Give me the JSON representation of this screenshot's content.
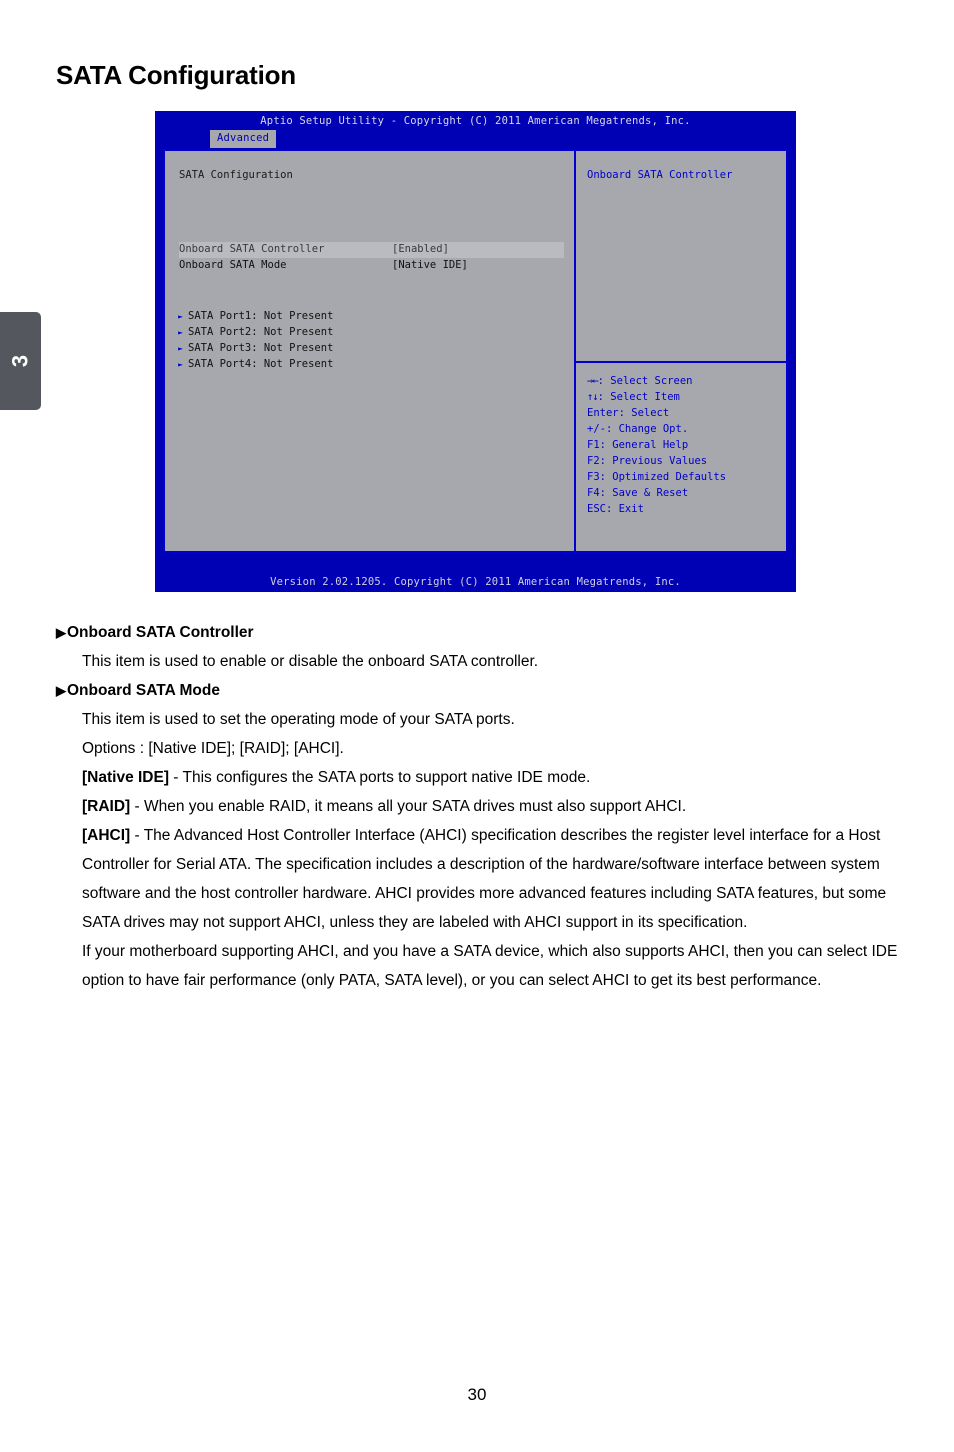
{
  "chapter": {
    "number": "3"
  },
  "page": {
    "title": "SATA Configuration",
    "number": "30"
  },
  "bios": {
    "titlebar": "Aptio Setup Utility - Copyright (C) 2011 American Megatrends, Inc.",
    "active_tab": "Advanced",
    "section_title": "SATA Configuration",
    "options": [
      {
        "label": "Onboard SATA Controller",
        "value": "[Enabled]",
        "selected": true
      },
      {
        "label": "Onboard SATA Mode",
        "value": "[Native IDE]",
        "selected": false
      }
    ],
    "ports": [
      {
        "label": "SATA Port1: Not Present"
      },
      {
        "label": "SATA Port2: Not Present"
      },
      {
        "label": "SATA Port3: Not Present"
      },
      {
        "label": "SATA Port4: Not Present"
      }
    ],
    "help_title": "Onboard SATA Controller",
    "keys": [
      {
        "glyph": "→←",
        "text": ": Select Screen"
      },
      {
        "glyph": "↑↓",
        "text": ": Select Item"
      },
      {
        "glyph": "",
        "text": "Enter: Select"
      },
      {
        "glyph": "",
        "text": "+/-: Change Opt."
      },
      {
        "glyph": "",
        "text": "F1: General Help"
      },
      {
        "glyph": "",
        "text": "F2: Previous Values"
      },
      {
        "glyph": "",
        "text": "F3: Optimized Defaults"
      },
      {
        "glyph": "",
        "text": "F4: Save & Reset"
      },
      {
        "glyph": "",
        "text": "ESC: Exit"
      }
    ],
    "footer": "Version 2.02.1205. Copyright (C) 2011 American Megatrends, Inc.",
    "colors": {
      "header_blue": "#0000b4",
      "panel_gray": "#a6a8ad",
      "border_blue": "#0000d0",
      "help_text_blue": "#0000c8"
    }
  },
  "content": {
    "item1_heading": "Onboard SATA Controller",
    "item1_desc": "This item is used to enable or disable the onboard SATA controller.",
    "item2_heading": "Onboard SATA Mode",
    "item2_desc": "This item is used to set the operating mode of your SATA ports.",
    "item2_options": "Options : [Native IDE]; [RAID]; [AHCI].",
    "native_ide_label": "[Native IDE]",
    "native_ide_desc": " - This configures the SATA ports to support native IDE mode.",
    "raid_label": "[RAID]",
    "raid_desc": " - When you enable RAID, it means all your SATA drives must also support AHCI.",
    "ahci_label": "[AHCI]",
    "ahci_desc": " - The Advanced Host Controller Interface (AHCI) specification describes the register level interface for a Host Controller for Serial ATA. The specification includes a description of the hardware/software interface between system software and the host controller hardware. AHCI provides more advanced features including SATA features, but some SATA drives may not support AHCI, unless they are labeled with AHCI support in its specification.",
    "closing_para": "If your motherboard supporting AHCI, and you have a SATA device, which also supports AHCI, then you can select IDE option to have fair performance (only PATA, SATA level), or you can select AHCI to get its best performance.",
    "bullet_glyph": "▶"
  }
}
